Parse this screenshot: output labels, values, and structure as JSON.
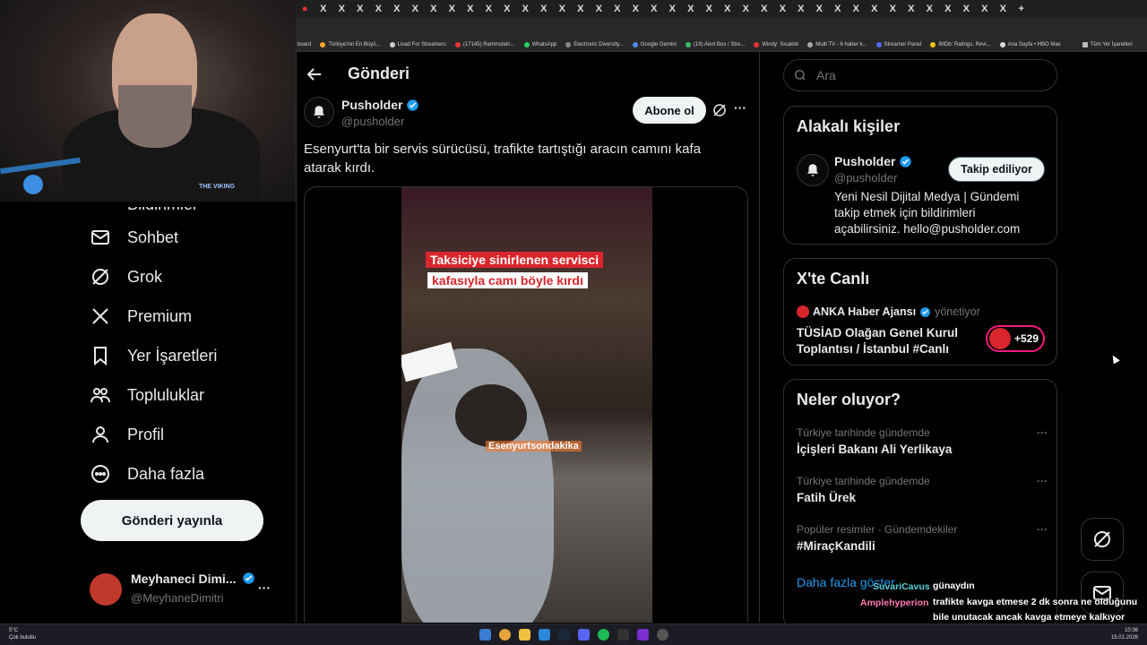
{
  "browser": {
    "tab_glyph": "X",
    "bookmarks": [
      "board",
      "Türkiye'nin En Büyü...",
      "Livad For Streamers",
      "(17145) Rammstein...",
      "WhatsApp",
      "Electronic Diversity...",
      "Google Gemini",
      "(19) Alert Box / Stre...",
      "Windy: Sıcaklık",
      "Multi TV - 6 haber k...",
      "Streamer Panel",
      "IMDb: Ratings, Revi...",
      "Ana Sayfa • HBO Max",
      "Tüm Yer İşaretleri"
    ]
  },
  "webcam": {
    "logo_text": "THE VIKING"
  },
  "nav": {
    "partial_item": "Bildirimler",
    "items": [
      {
        "label": "Sohbet",
        "icon": "mail-icon"
      },
      {
        "label": "Grok",
        "icon": "grok-icon"
      },
      {
        "label": "Premium",
        "icon": "x-logo-icon"
      },
      {
        "label": "Yer İşaretleri",
        "icon": "bookmark-icon"
      },
      {
        "label": "Topluluklar",
        "icon": "communities-icon"
      },
      {
        "label": "Profil",
        "icon": "profile-icon"
      },
      {
        "label": "Daha fazla",
        "icon": "more-circle-icon"
      }
    ],
    "post_button": "Gönderi yayınla",
    "account": {
      "name": "Meyhaneci Dimi...",
      "handle": "@MeyhaneDimitri",
      "more": "···"
    }
  },
  "main": {
    "title": "Gönderi",
    "author": {
      "name": "Pusholder",
      "handle": "@pusholder"
    },
    "subscribe_label": "Abone ol",
    "more": "···",
    "post_text": "Esenyurt'ta bir servis sürücüsü, trafikte tartıştığı aracın camını kafa atarak kırdı.",
    "video": {
      "caption_line1": "Taksiciye sinirlenen servisci",
      "caption_line2": "kafasıyla camı böyle kırdı",
      "watermark": "Esenyurtsondakika"
    }
  },
  "right": {
    "search_placeholder": "Ara",
    "related": {
      "title": "Alakalı kişiler",
      "name": "Pusholder",
      "handle": "@pusholder",
      "follow_label": "Takip ediliyor",
      "bio": "Yeni Nesil Dijital Medya | Gündemi takip etmek için bildirimleri açabilirsiniz. hello@pusholder.com"
    },
    "live": {
      "title": "X'te Canlı",
      "host": "ANKA Haber Ajansı",
      "role": "yönetiyor",
      "event_title": "TÜSİAD Olağan Genel Kurul Toplantısı / İstanbul #Canlı",
      "listener_count": "+529"
    },
    "trends": {
      "title": "Neler oluyor?",
      "items": [
        {
          "context": "Türkiye tarihinde gündemde",
          "topic": "İçişleri Bakanı Ali Yerlikaya"
        },
        {
          "context": "Türkiye tarihinde gündemde",
          "topic": "Fatih Ürek"
        },
        {
          "context": "Popüler resimler · Gündemdekiler",
          "topic": "#MiraçKandili"
        }
      ],
      "dots": "···",
      "show_more": "Daha fazla göster"
    }
  },
  "chat": [
    {
      "user": "SuvariCavus",
      "message": "günaydın"
    },
    {
      "user": "Amplehyperion",
      "message": "trafikte kavga etmese 2 dk sonra ne olduğunu bile unutacak ancak kavga etmeye kalkıyor herkes"
    }
  ],
  "taskbar": {
    "weather_temp": "5°C",
    "weather_desc": "Çok bulutlu",
    "time": "10:36",
    "date": "15.01.2026"
  },
  "colors": {
    "accent_blue": "#1d9bf0",
    "verified_blue": "#1d9bf0",
    "live_pink": "#f91880",
    "caption_red": "#d9262c"
  }
}
